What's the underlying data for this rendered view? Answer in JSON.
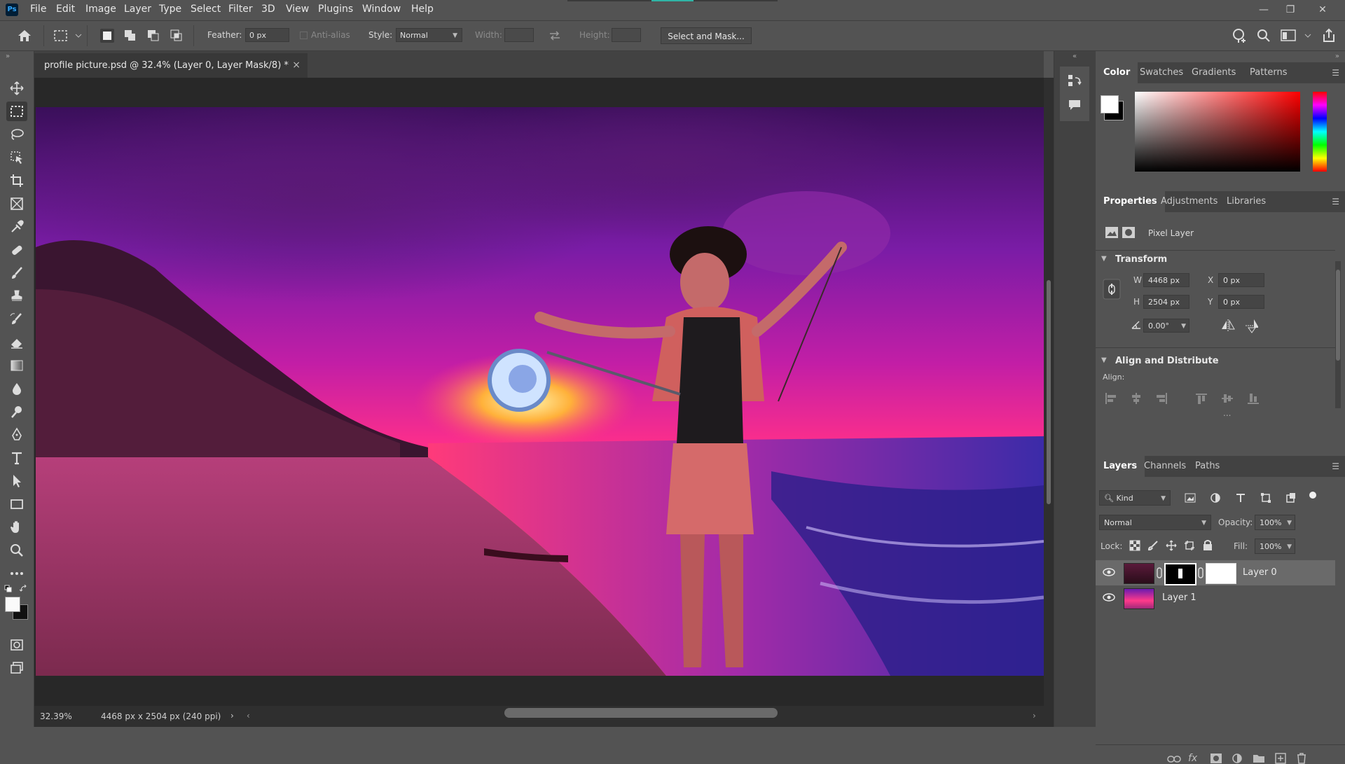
{
  "app": {
    "logo": "Ps"
  },
  "menu": [
    "File",
    "Edit",
    "Image",
    "Layer",
    "Type",
    "Select",
    "Filter",
    "3D",
    "View",
    "Plugins",
    "Window",
    "Help"
  ],
  "window_controls": {
    "minimize": "—",
    "restore": "❐",
    "close": "✕"
  },
  "options": {
    "feather_label": "Feather:",
    "feather_value": "0 px",
    "antialias_label": "Anti-alias",
    "style_label": "Style:",
    "style_value": "Normal",
    "width_label": "Width:",
    "height_label": "Height:",
    "select_mask_label": "Select and Mask..."
  },
  "document": {
    "tab_title": "profile picture.psd @ 32.4% (Layer 0, Layer Mask/8) *",
    "close": "×"
  },
  "status": {
    "zoom": "32.39%",
    "doc_info": "4468 px x 2504 px (240 ppi)",
    "arrow": "›"
  },
  "color_panel": {
    "tabs": [
      "Color",
      "Swatches",
      "Gradients",
      "Patterns"
    ]
  },
  "properties_panel": {
    "tabs": [
      "Properties",
      "Adjustments",
      "Libraries"
    ],
    "layer_type": "Pixel Layer",
    "transform_title": "Transform",
    "w_label": "W",
    "w_value": "4468 px",
    "h_label": "H",
    "h_value": "2504 px",
    "x_label": "X",
    "x_value": "0 px",
    "y_label": "Y",
    "y_value": "0 px",
    "angle_value": "0.00°",
    "align_title": "Align and Distribute",
    "align_label": "Align:",
    "more": "..."
  },
  "layers_panel": {
    "tabs": [
      "Layers",
      "Channels",
      "Paths"
    ],
    "kind": "Kind",
    "blend_mode": "Normal",
    "opacity_label": "Opacity:",
    "opacity_value": "100%",
    "lock_label": "Lock:",
    "fill_label": "Fill:",
    "fill_value": "100%",
    "layers": [
      {
        "name": "Layer 0",
        "selected": true
      },
      {
        "name": "Layer 1",
        "selected": false
      }
    ]
  },
  "colors": {
    "accent": "#31a8ff",
    "panel_bg": "#535353",
    "dark_bg": "#282828"
  }
}
